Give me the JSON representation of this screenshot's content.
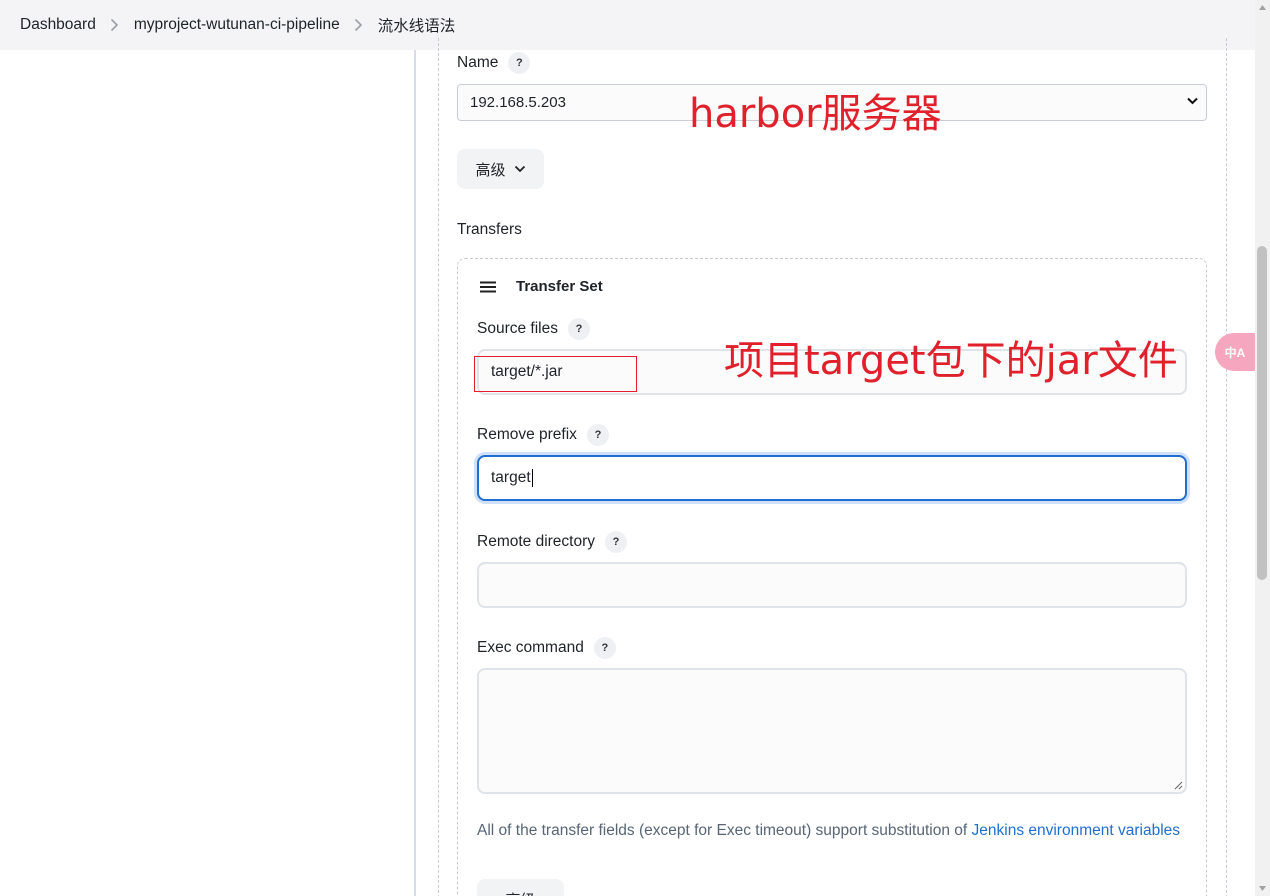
{
  "breadcrumb": {
    "items": [
      "Dashboard",
      "myproject-wutunan-ci-pipeline",
      "流水线语法"
    ]
  },
  "server": {
    "name_label": "Name",
    "help": "?",
    "selected": "192.168.5.203",
    "advanced_label": "高级"
  },
  "transfers": {
    "label": "Transfers",
    "set_title": "Transfer Set",
    "source_files": {
      "label": "Source files",
      "value": "target/*.jar"
    },
    "remove_prefix": {
      "label": "Remove prefix",
      "value": "target"
    },
    "remote_directory": {
      "label": "Remote directory",
      "value": ""
    },
    "exec_command": {
      "label": "Exec command",
      "value": ""
    },
    "note_text": "All of the transfer fields (except for Exec timeout) support substitution of ",
    "note_link": "Jenkins environment variables",
    "advanced_label": "高级"
  },
  "annotations": {
    "server": "harbor服务器",
    "source": "项目target包下的jar文件"
  },
  "translate_button": "中A",
  "colors": {
    "annotation": "#e0202a",
    "link": "#1f6fd1",
    "focus": "#1f6fd1"
  }
}
